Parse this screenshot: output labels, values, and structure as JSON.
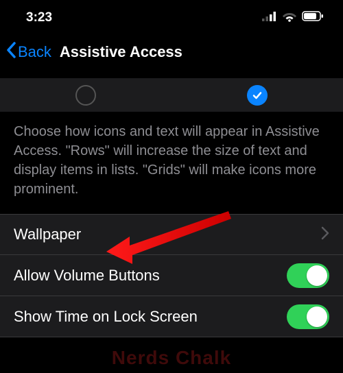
{
  "status": {
    "time": "3:23"
  },
  "nav": {
    "back_label": "Back",
    "title": "Assistive Access"
  },
  "description": "Choose how icons and text will appear in Assistive Access. \"Rows\" will increase the size of text and display items in lists. \"Grids\" will make icons more prominent.",
  "rows": {
    "wallpaper": {
      "label": "Wallpaper"
    },
    "volume": {
      "label": "Allow Volume Buttons",
      "on": true
    },
    "locktime": {
      "label": "Show Time on Lock Screen",
      "on": true
    }
  },
  "watermark": "Nerds Chalk"
}
